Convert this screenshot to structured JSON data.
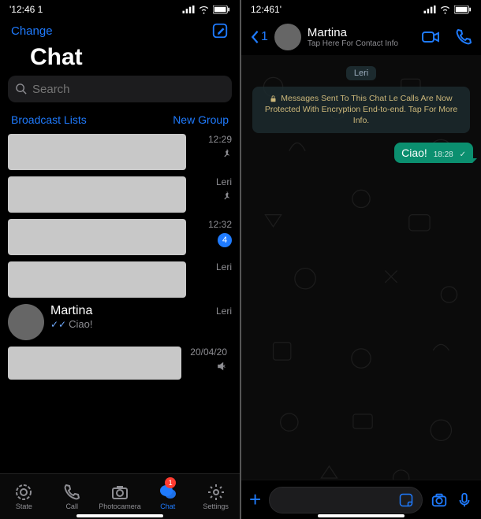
{
  "left": {
    "status_time": "'12:46 1",
    "topbar_edit": "Change",
    "title": "Chat",
    "search_placeholder": "Search",
    "broadcast": "Broadcast Lists",
    "new_group": "New Group",
    "rows": [
      {
        "time": "12:29",
        "pin": true
      },
      {
        "time": "Leri",
        "pin": true
      },
      {
        "time": "12:32",
        "badge": "4"
      },
      {
        "time": "Leri"
      },
      {
        "name": "Martina",
        "msg": "Ciao!",
        "time": "Leri",
        "avatar": true
      },
      {
        "time": "20/04/20",
        "muted": true
      }
    ],
    "tabs": {
      "state": "State",
      "call": "Call",
      "camera": "Photocamera",
      "chat": "Chat",
      "settings": "Settings",
      "chat_badge": "1"
    }
  },
  "right": {
    "status_time": "12:461'",
    "back_count": "1",
    "header_name": "Martina",
    "header_sub": "Tap Here For Contact Info",
    "day": "Leri",
    "encryption": "Messages Sent To This Chat Le Calls Are Now Protected With Encryption End-to-end. Tap For More Info.",
    "bubble_text": "Ciao!",
    "bubble_time": "18:28",
    "bubble_tick": "✓"
  }
}
